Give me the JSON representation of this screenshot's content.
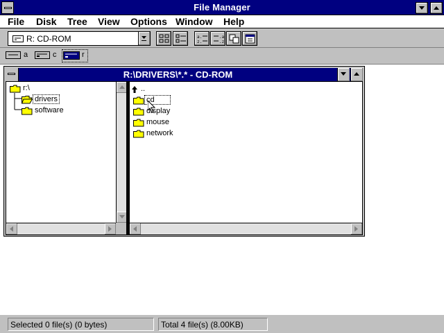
{
  "app": {
    "title": "File Manager"
  },
  "menu": {
    "items": [
      {
        "label": "File"
      },
      {
        "label": "Disk"
      },
      {
        "label": "Tree"
      },
      {
        "label": "View"
      },
      {
        "label": "Options"
      },
      {
        "label": "Window"
      },
      {
        "label": "Help"
      }
    ]
  },
  "toolbar": {
    "drive_selector": "R: CD-ROM",
    "buttons": [
      {
        "icon": "connect-net-drive-icon"
      },
      {
        "icon": "disconnect-net-drive-icon"
      },
      {
        "icon": "view-name-icon"
      },
      {
        "icon": "view-details-icon"
      },
      {
        "icon": "sort-name-icon"
      },
      {
        "icon": "sort-type-icon"
      },
      {
        "icon": "copy-disk-icon"
      },
      {
        "icon": "properties-icon"
      }
    ]
  },
  "drives": [
    {
      "letter": "a",
      "icon": "floppy-drive-icon",
      "selected": false
    },
    {
      "letter": "c",
      "icon": "hard-drive-icon",
      "selected": false
    },
    {
      "letter": "r",
      "icon": "cdrom-drive-icon",
      "selected": true
    }
  ],
  "child_window": {
    "title": "R:\\DRIVERS\\*.* - CD-ROM",
    "tree": {
      "items": [
        {
          "label": "r:\\",
          "level": 0,
          "icon": "folder-open-icon",
          "selected": false
        },
        {
          "label": "drivers",
          "level": 1,
          "icon": "folder-open-icon",
          "selected": true
        },
        {
          "label": "software",
          "level": 1,
          "icon": "folder-icon",
          "selected": false
        }
      ]
    },
    "directory": {
      "items": [
        {
          "label": "..",
          "icon": "up-arrow-icon",
          "selected": false
        },
        {
          "label": "cd",
          "icon": "folder-icon",
          "selected": true
        },
        {
          "label": "display",
          "icon": "folder-icon",
          "selected": false
        },
        {
          "label": "mouse",
          "icon": "folder-icon",
          "selected": false
        },
        {
          "label": "network",
          "icon": "folder-icon",
          "selected": false
        }
      ]
    }
  },
  "status": {
    "selected": "Selected 0 file(s) (0 bytes)",
    "total": "Total 4 file(s) (8.00KB)"
  },
  "colors": {
    "title_bar": "#000080",
    "face": "#c0c0c0",
    "folder": "#ffff00"
  }
}
